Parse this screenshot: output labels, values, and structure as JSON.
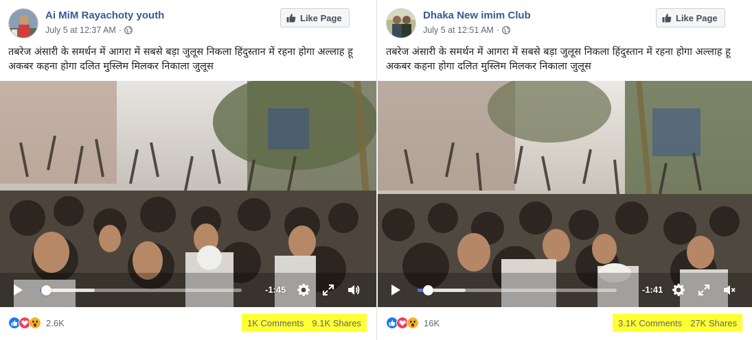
{
  "posts": [
    {
      "page_name": "Ai MiM Rayachoty youth",
      "timestamp": "July 5 at 12:37 AM",
      "like_page_label": "Like Page",
      "caption_line1": "तबरेज अंसारी के समर्थन में आगरा में सबसे बड़ा जुलूस निकला हिंदुस्तान में रहना होगा अल्लाह हू",
      "caption_line2": "अकबर कहना होगा दलित मुस्लिम मिलकर निकाला जुलूस",
      "video_time_remaining": "-1:45",
      "video_progress": 0.03,
      "reaction_count": "2.6K",
      "comments": "1K Comments",
      "shares": "9.1K Shares"
    },
    {
      "page_name": "Dhaka New imim Club",
      "timestamp": "July 5 at 12:51 AM",
      "like_page_label": "Like Page",
      "caption_line1": "तबरेज अंसारी के समर्थन में आगरा में सबसे बड़ा जुलूस निकला हिंदुस्तान में रहना होगा अल्लाह हू",
      "caption_line2": "अकबर कहना होगा दलित मुस्लिम मिलकर निकाला जुलूस",
      "video_time_remaining": "-1:41",
      "video_progress": 0.05,
      "reaction_count": "16K",
      "comments": "3.1K Comments",
      "shares": "27K Shares"
    }
  ],
  "icons": {
    "like_page": "thumbs-up-icon",
    "privacy": "globe-icon",
    "play": "play-icon",
    "settings": "gear-icon",
    "fullscreen": "fullscreen-icon",
    "volume_left": "volume-icon",
    "volume_right": "mute-icon",
    "reactions": [
      "like-reaction-icon",
      "love-reaction-icon",
      "wow-reaction-icon"
    ]
  },
  "colors": {
    "page_name": "#385898",
    "highlight": "#ffff33",
    "seek_fill": "#4a76e8",
    "like_blue": "#1877f2",
    "love_red": "#f33e58",
    "wow_yellow": "#f7b125"
  }
}
